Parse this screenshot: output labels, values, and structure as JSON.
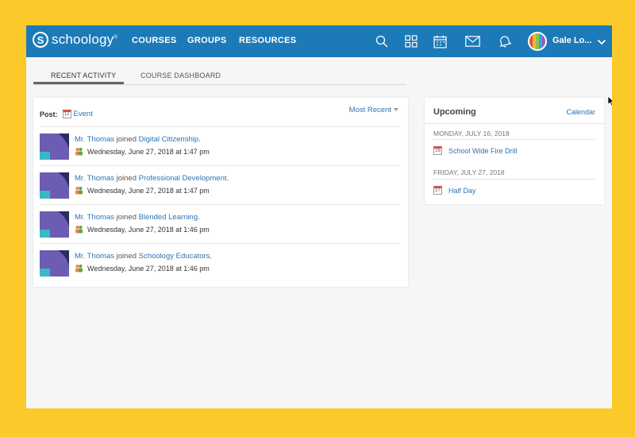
{
  "app": {
    "logo_glyph": "S",
    "logo_text": "schoology",
    "logo_mark": "®"
  },
  "nav": {
    "links": [
      "COURSES",
      "GROUPS",
      "RESOURCES"
    ],
    "icons": [
      "search-icon",
      "apps-grid-icon",
      "calendar-icon",
      "mail-icon",
      "bell-icon"
    ],
    "user_name": "Gale Lo...",
    "accent": "#1c7ab8"
  },
  "tabs": [
    {
      "label": "RECENT ACTIVITY",
      "active": true
    },
    {
      "label": "COURSE DASHBOARD",
      "active": false
    }
  ],
  "activity": {
    "post_label": "Post:",
    "post_event": "Event",
    "calendar_glyph_day": "12",
    "sort_label": "Most Recent",
    "items": [
      {
        "actor": "Mr. Thomas",
        "verb": "joined",
        "target": "Digital Citizenship",
        "time": "Wednesday, June 27, 2018 at 1:47 pm"
      },
      {
        "actor": "Mr. Thomas",
        "verb": "joined",
        "target": "Professional Development",
        "time": "Wednesday, June 27, 2018 at 1:47 pm"
      },
      {
        "actor": "Mr. Thomas",
        "verb": "joined",
        "target": "Blended Learning",
        "time": "Wednesday, June 27, 2018 at 1:46 pm"
      },
      {
        "actor": "Mr. Thomas",
        "verb": "joined",
        "target": "Schoology Educators",
        "time": "Wednesday, June 27, 2018 at 1:46 pm"
      }
    ]
  },
  "upcoming": {
    "title": "Upcoming",
    "calendar_link": "Calendar",
    "groups": [
      {
        "date": "MONDAY, JULY 16, 2018",
        "day": "16",
        "event": "School Wide Fire Drill"
      },
      {
        "date": "FRIDAY, JULY 27, 2018",
        "day": "27",
        "event": "Half Day"
      }
    ]
  },
  "colors": {
    "background": "#fcc92b",
    "link": "#2c73b5"
  }
}
